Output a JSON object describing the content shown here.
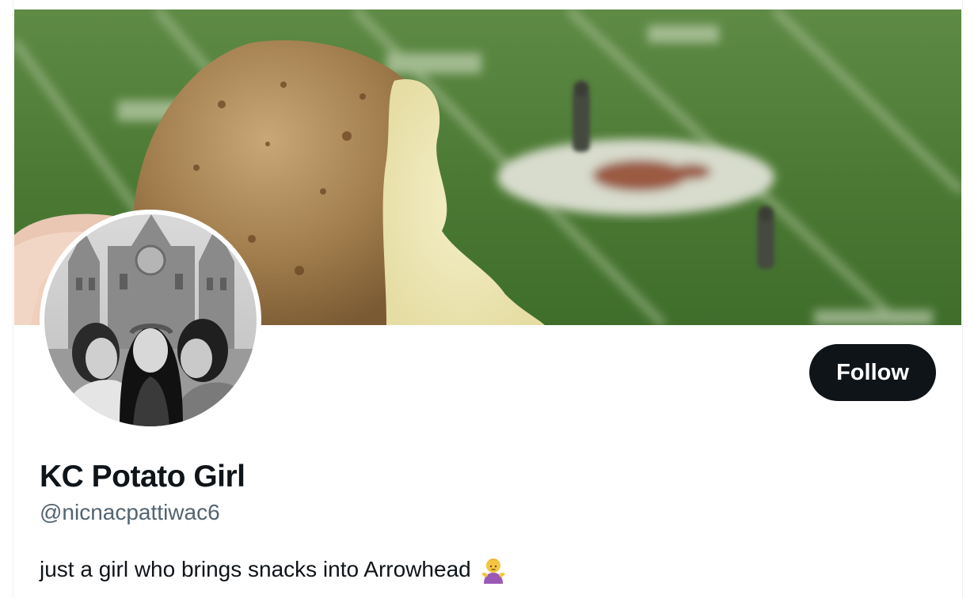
{
  "profile": {
    "display_name": "KC Potato Girl",
    "handle": "@nicnacpattiwac6",
    "bio": "just a girl who brings snacks into Arrowhead",
    "bio_emoji": "person-shrugging-emoji",
    "follow_label": "Follow"
  },
  "banner": {
    "description_icon": "banner-photo"
  },
  "avatar": {
    "icon": "avatar-photo"
  },
  "colors": {
    "follow_bg": "#0f1419",
    "follow_text": "#ffffff",
    "name_text": "#0f1419",
    "handle_text": "#536471",
    "field_green": "#4f7a39"
  }
}
